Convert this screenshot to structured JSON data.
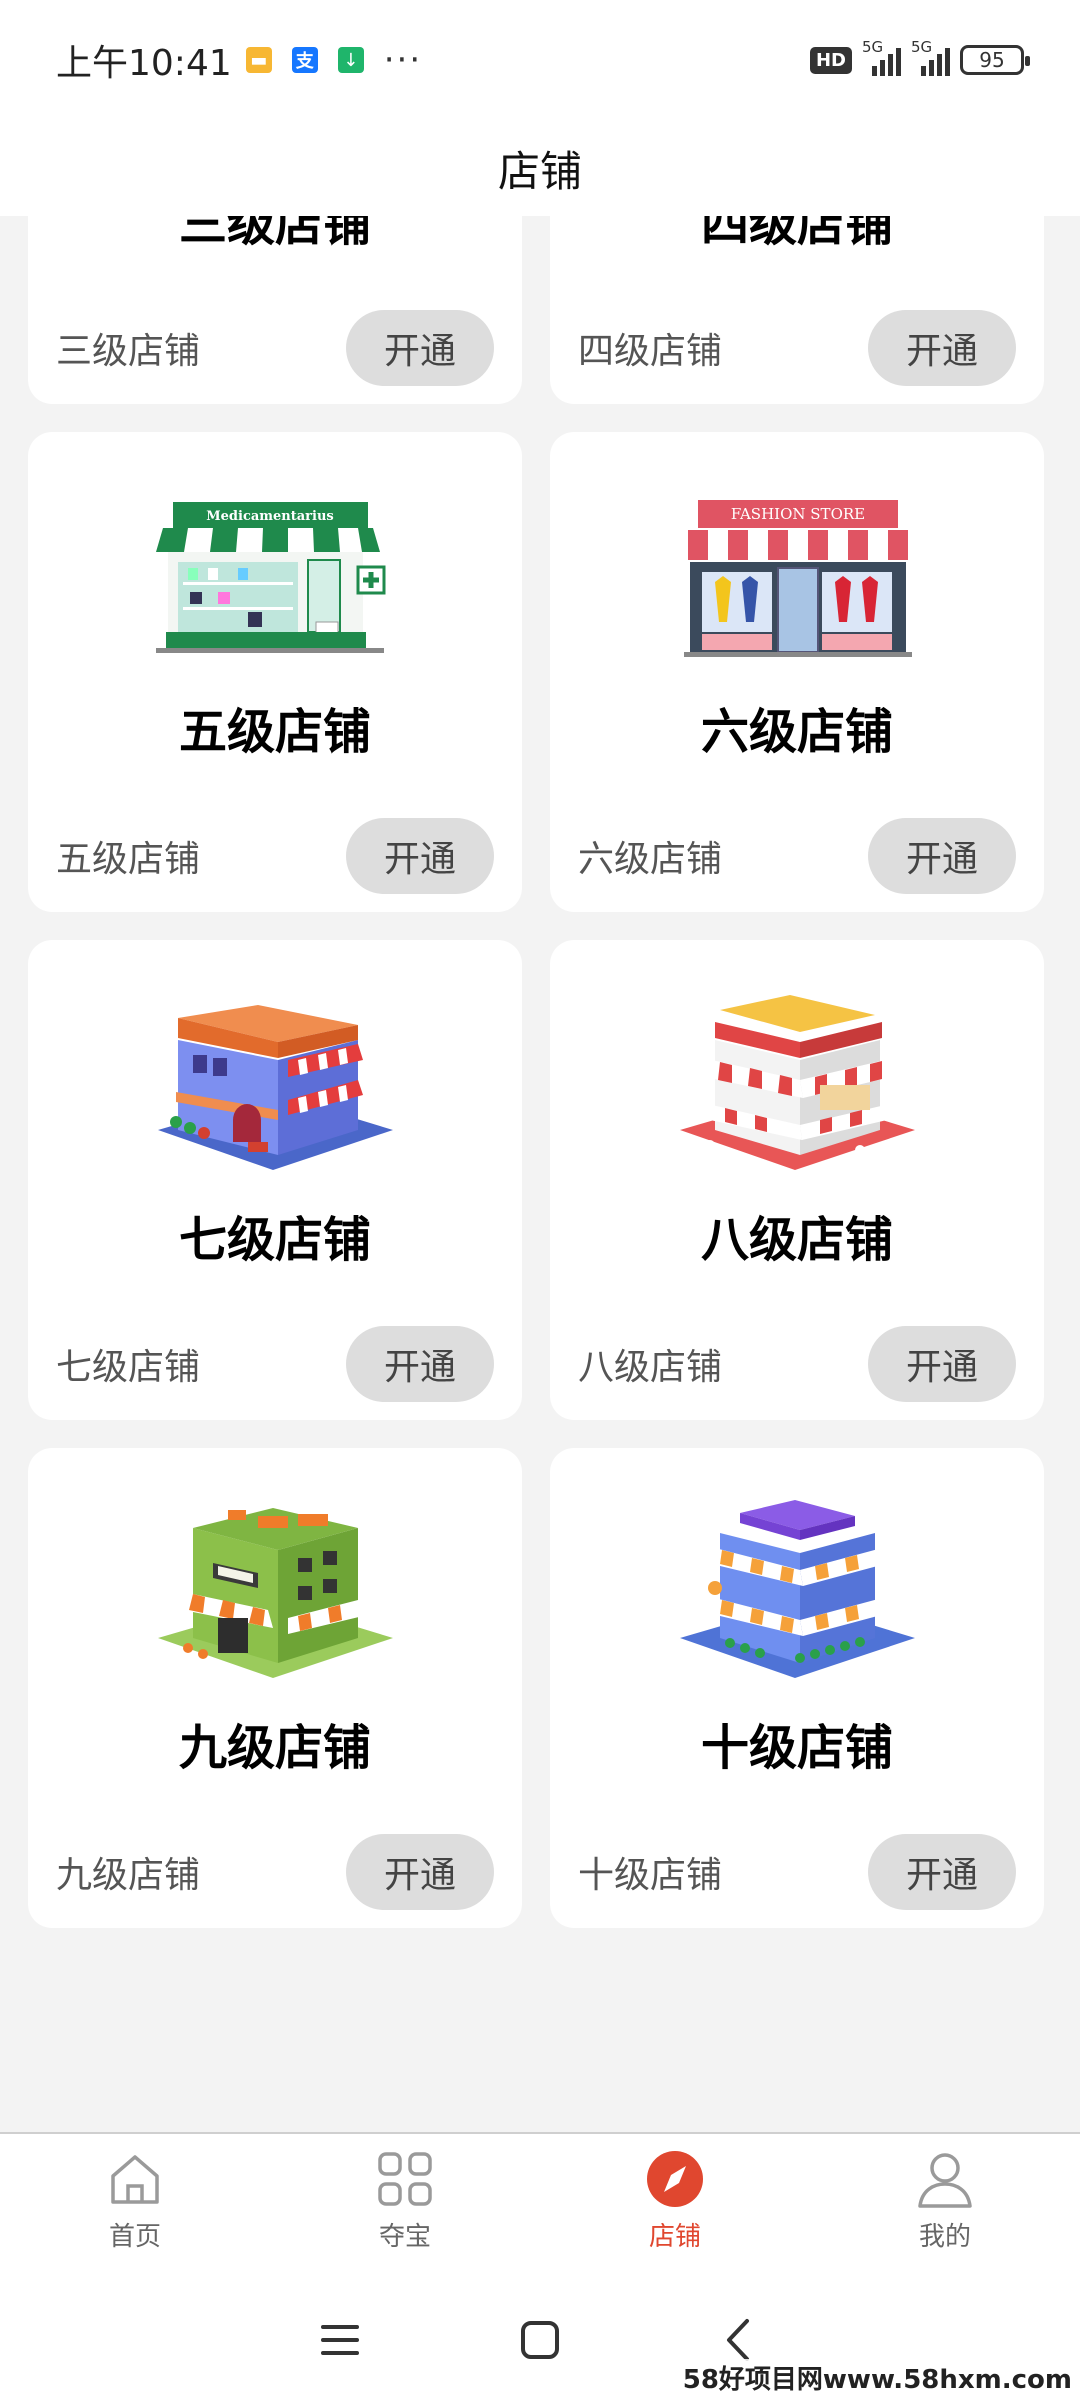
{
  "status_bar": {
    "time": "上午10:41",
    "notifications": [
      "message-icon",
      "alipay-icon",
      "download-icon"
    ],
    "more": "···",
    "hd": "HD",
    "network": [
      "5G",
      "5G"
    ],
    "battery": "95"
  },
  "header": {
    "title": "店铺"
  },
  "shops": [
    {
      "name": "三级店铺",
      "desc": "三级店铺",
      "button": "开通"
    },
    {
      "name": "四级店铺",
      "desc": "四级店铺",
      "button": "开通"
    },
    {
      "name": "五级店铺",
      "desc": "五级店铺",
      "button": "开通",
      "sign": "Medicamentarius"
    },
    {
      "name": "六级店铺",
      "desc": "六级店铺",
      "button": "开通",
      "sign": "FASHION STORE"
    },
    {
      "name": "七级店铺",
      "desc": "七级店铺",
      "button": "开通"
    },
    {
      "name": "八级店铺",
      "desc": "八级店铺",
      "button": "开通"
    },
    {
      "name": "九级店铺",
      "desc": "九级店铺",
      "button": "开通"
    },
    {
      "name": "十级店铺",
      "desc": "十级店铺",
      "button": "开通"
    }
  ],
  "tabbar": {
    "items": [
      {
        "label": "首页",
        "icon": "home-icon"
      },
      {
        "label": "夺宝",
        "icon": "grid-icon"
      },
      {
        "label": "店铺",
        "icon": "compass-icon",
        "active": true
      },
      {
        "label": "我的",
        "icon": "user-icon"
      }
    ],
    "active_color": "#e0472f"
  },
  "watermark": "58好项目网www.58hxm.com"
}
